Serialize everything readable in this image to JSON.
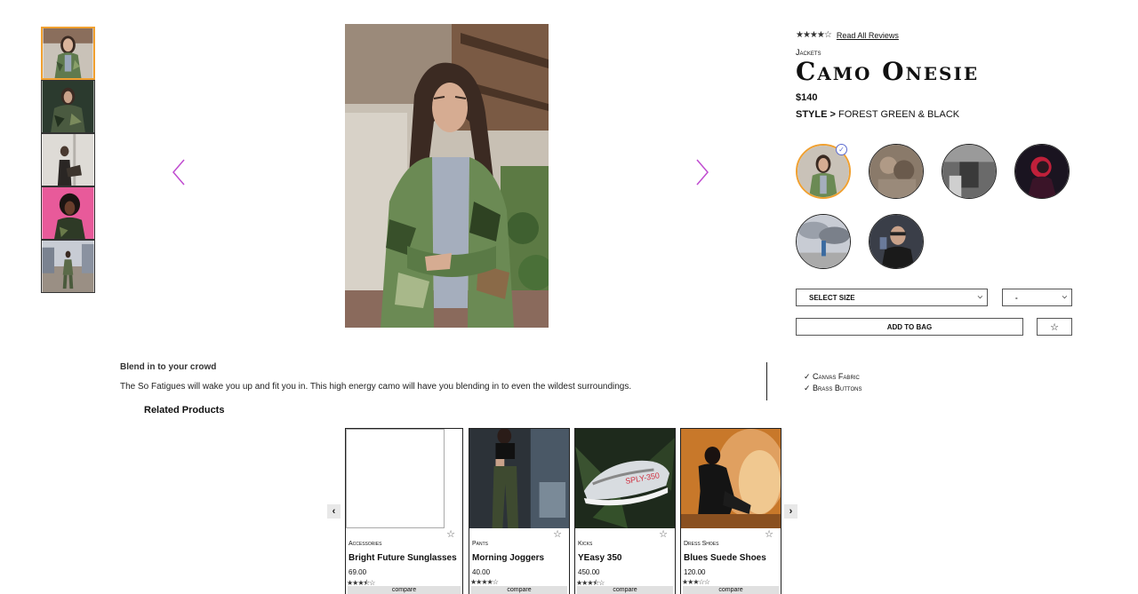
{
  "thumbnails": [
    {
      "alt": "camo-jacket-model-front",
      "selected": true
    },
    {
      "alt": "camo-jacket-model-dark"
    },
    {
      "alt": "model-with-bag"
    },
    {
      "alt": "model-pink-background"
    },
    {
      "alt": "model-street"
    }
  ],
  "product": {
    "stars": "★★★★☆",
    "reviews_link": "Read All Reviews",
    "category": "Jackets",
    "title": "Camo Onesie",
    "price": "$140",
    "style_label": "STYLE >",
    "style_value": "FOREST GREEN & BLACK",
    "size_select": "SELECT SIZE",
    "qty_select": "-",
    "add_to_bag": "ADD TO BAG",
    "favorite": "☆",
    "swatch_check": "✓"
  },
  "description": {
    "title": "Blend in to your crowd",
    "text": "The So Fatigues will wake you up and fit you in. This high energy camo will have you blending in to even the wildest surroundings."
  },
  "features": [
    "✓ Canvas Fabric",
    "✓ Brass Buttons"
  ],
  "related": {
    "title": "Related Products",
    "items": [
      {
        "category": "Accessories",
        "name": "Bright Future Sunglasses",
        "price": "69.00",
        "stars": "★★★⯪☆",
        "compare": "compare"
      },
      {
        "category": "Pants",
        "name": "Morning Joggers",
        "price": "40.00",
        "stars": "★★★★☆",
        "compare": "compare"
      },
      {
        "category": "Kicks",
        "name": "YEasy 350",
        "price": "450.00",
        "stars": "★★★⯪☆",
        "compare": "compare"
      },
      {
        "category": "Dress Shoes",
        "name": "Blues Suede Shoes",
        "price": "120.00",
        "stars": "★★★☆☆",
        "compare": "compare"
      }
    ],
    "fav_icon": "☆",
    "prev": "‹",
    "next": "›"
  },
  "colors": {
    "accent": "#f0a030",
    "arrow": "#c04cd0",
    "check": "#5a6acf"
  }
}
